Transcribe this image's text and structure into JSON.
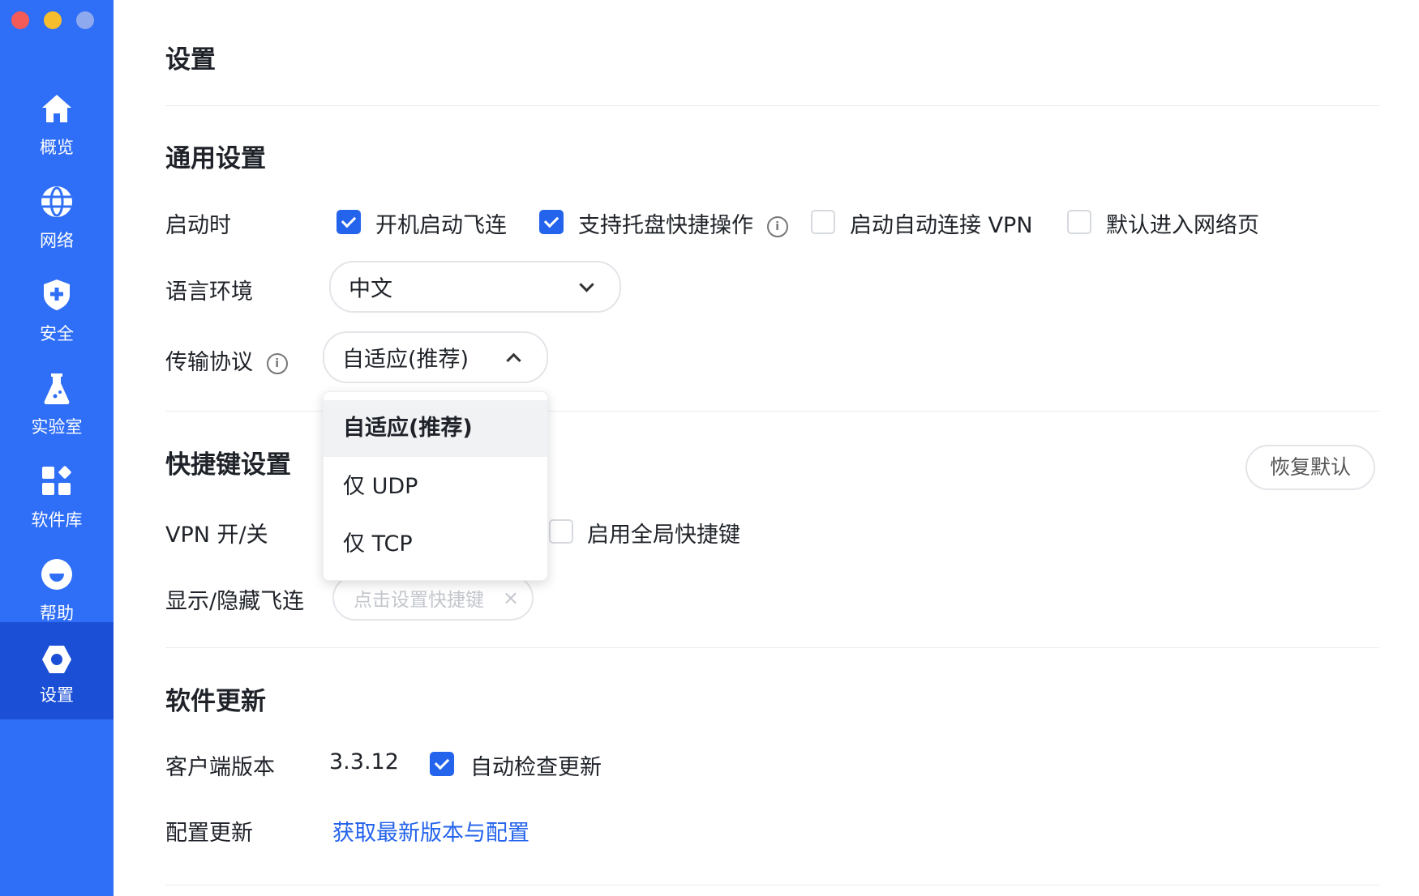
{
  "window": {
    "controls": [
      "close",
      "minimize",
      "zoom"
    ]
  },
  "sidebar": {
    "items": [
      {
        "label": "概览",
        "icon": "home-icon"
      },
      {
        "label": "网络",
        "icon": "globe-icon"
      },
      {
        "label": "安全",
        "icon": "shield-icon"
      },
      {
        "label": "实验室",
        "icon": "flask-icon"
      },
      {
        "label": "软件库",
        "icon": "apps-icon"
      },
      {
        "label": "帮助",
        "icon": "help-icon"
      },
      {
        "label": "设置",
        "icon": "settings-icon",
        "active": true
      }
    ]
  },
  "page": {
    "title": "设置"
  },
  "general": {
    "title": "通用设置",
    "startup": {
      "label": "启动时",
      "options": [
        {
          "label": "开机启动飞连",
          "checked": true
        },
        {
          "label": "支持托盘快捷操作",
          "checked": true,
          "info": true
        },
        {
          "label": "启动自动连接 VPN",
          "checked": false
        },
        {
          "label": "默认进入网络页",
          "checked": false
        }
      ]
    },
    "language": {
      "label": "语言环境",
      "value": "中文"
    },
    "protocol": {
      "label": "传输协议",
      "value": "自适应(推荐)",
      "options": [
        "自适应(推荐)",
        "仅 UDP",
        "仅 TCP"
      ],
      "expanded": true
    }
  },
  "shortcuts": {
    "title": "快捷键设置",
    "reset_label": "恢复默认",
    "vpn_toggle": {
      "label": "VPN 开/关"
    },
    "global_shortcut": {
      "label": "启用全局快捷键",
      "checked": false
    },
    "show_hide": {
      "label": "显示/隐藏飞连",
      "placeholder": "点击设置快捷键",
      "clear": "×"
    }
  },
  "update": {
    "title": "软件更新",
    "client_version": {
      "label": "客户端版本",
      "value": "3.3.12"
    },
    "auto_check": {
      "label": "自动检查更新",
      "checked": true
    },
    "config_update": {
      "label": "配置更新",
      "link": "获取最新版本与配置"
    }
  },
  "colors": {
    "sidebar": "#2f6ef6",
    "sidebar_active": "#1b4fd6",
    "accent": "#2463eb"
  }
}
